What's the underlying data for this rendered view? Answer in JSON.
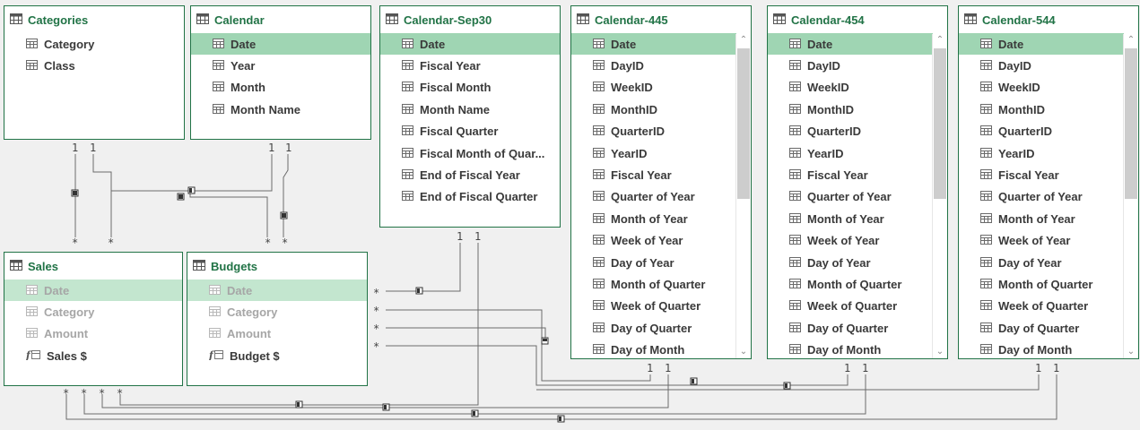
{
  "tables": [
    {
      "id": "categories",
      "title": "Categories",
      "fields": [
        {
          "label": "Category"
        },
        {
          "label": "Class"
        }
      ]
    },
    {
      "id": "calendar",
      "title": "Calendar",
      "fields": [
        {
          "label": "Date",
          "state": "sel"
        },
        {
          "label": "Year"
        },
        {
          "label": "Month"
        },
        {
          "label": "Month Name"
        }
      ]
    },
    {
      "id": "calendar-sep30",
      "title": "Calendar-Sep30",
      "fields": [
        {
          "label": "Date",
          "state": "sel"
        },
        {
          "label": "Fiscal Year"
        },
        {
          "label": "Fiscal Month"
        },
        {
          "label": "Month Name"
        },
        {
          "label": "Fiscal Quarter"
        },
        {
          "label": "Fiscal Month of Quar..."
        },
        {
          "label": "End of Fiscal Year"
        },
        {
          "label": "End of Fiscal Quarter"
        }
      ]
    },
    {
      "id": "calendar-445",
      "title": "Calendar-445",
      "fields": [
        {
          "label": "Date",
          "state": "sel"
        },
        {
          "label": "DayID"
        },
        {
          "label": "WeekID"
        },
        {
          "label": "MonthID"
        },
        {
          "label": "QuarterID"
        },
        {
          "label": "YearID"
        },
        {
          "label": "Fiscal Year"
        },
        {
          "label": "Quarter of Year"
        },
        {
          "label": "Month of Year"
        },
        {
          "label": "Week of Year"
        },
        {
          "label": "Day of Year"
        },
        {
          "label": "Month of Quarter"
        },
        {
          "label": "Week of Quarter"
        },
        {
          "label": "Day of Quarter"
        },
        {
          "label": "Day of Month"
        }
      ]
    },
    {
      "id": "calendar-454",
      "title": "Calendar-454",
      "fields": [
        {
          "label": "Date",
          "state": "sel"
        },
        {
          "label": "DayID"
        },
        {
          "label": "WeekID"
        },
        {
          "label": "MonthID"
        },
        {
          "label": "QuarterID"
        },
        {
          "label": "YearID"
        },
        {
          "label": "Fiscal Year"
        },
        {
          "label": "Quarter of Year"
        },
        {
          "label": "Month of Year"
        },
        {
          "label": "Week of Year"
        },
        {
          "label": "Day of Year"
        },
        {
          "label": "Month of Quarter"
        },
        {
          "label": "Week of Quarter"
        },
        {
          "label": "Day of Quarter"
        },
        {
          "label": "Day of Month"
        }
      ]
    },
    {
      "id": "calendar-544",
      "title": "Calendar-544",
      "fields": [
        {
          "label": "Date",
          "state": "sel"
        },
        {
          "label": "DayID"
        },
        {
          "label": "WeekID"
        },
        {
          "label": "MonthID"
        },
        {
          "label": "QuarterID"
        },
        {
          "label": "YearID"
        },
        {
          "label": "Fiscal Year"
        },
        {
          "label": "Quarter of Year"
        },
        {
          "label": "Month of Year"
        },
        {
          "label": "Week of Year"
        },
        {
          "label": "Day of Year"
        },
        {
          "label": "Month of Quarter"
        },
        {
          "label": "Week of Quarter"
        },
        {
          "label": "Day of Quarter"
        },
        {
          "label": "Day of Month"
        }
      ]
    },
    {
      "id": "sales",
      "title": "Sales",
      "fields": [
        {
          "label": "Date",
          "state": "dimsel"
        },
        {
          "label": "Category",
          "state": "dim"
        },
        {
          "label": "Amount",
          "state": "dim"
        },
        {
          "label": "Sales $",
          "measure": true
        }
      ]
    },
    {
      "id": "budgets",
      "title": "Budgets",
      "fields": [
        {
          "label": "Date",
          "state": "dimsel"
        },
        {
          "label": "Category",
          "state": "dim"
        },
        {
          "label": "Amount",
          "state": "dim"
        },
        {
          "label": "Budget $",
          "measure": true
        }
      ]
    }
  ],
  "cardinality": {
    "one": "1",
    "many": "*"
  },
  "colors": {
    "accent": "#217346",
    "selected_row": "#9fd5b3",
    "line": "#555555"
  }
}
